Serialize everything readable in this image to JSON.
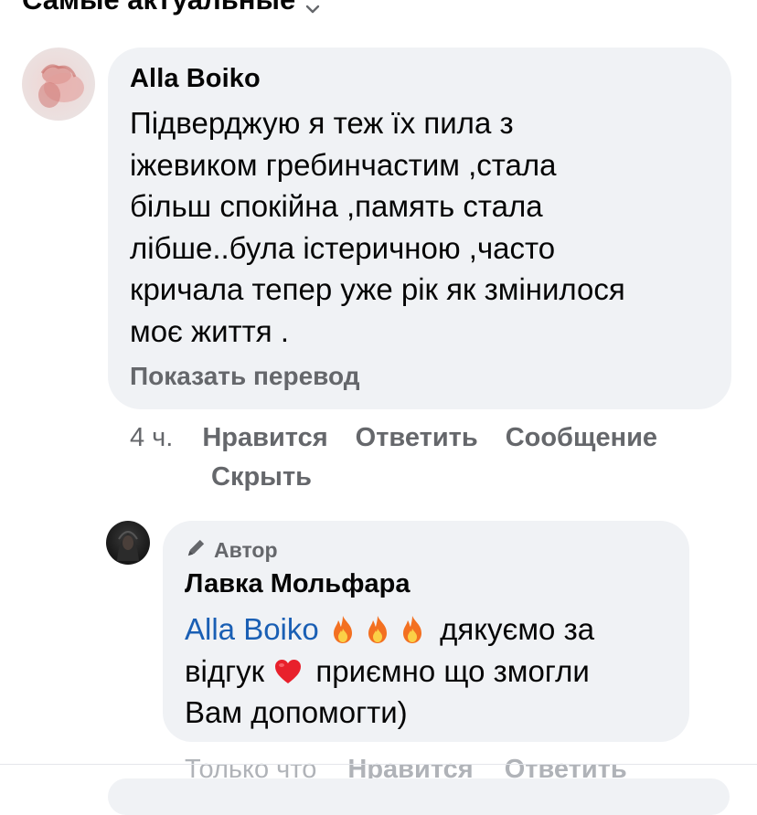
{
  "sort": {
    "label": "Самые актуальные"
  },
  "comment": {
    "author": "Alla Boiko",
    "lines": [
      "Підверджую я теж їх пила з",
      "іжевиком гребинчастим ,стала",
      "більш спокійна ,память стала",
      "лібше..була істеричною ,часто",
      "кричала тепер уже рік як змінилося",
      "моє життя ."
    ],
    "translate": "Показать перевод",
    "time": "4 ч.",
    "like": "Нравится",
    "reply": "Ответить",
    "message": "Сообщение",
    "hide": "Скрыть"
  },
  "reply": {
    "badge": "Автор",
    "author": "Лавка Мольфара",
    "mention": "Alla Boiko",
    "text_after_fire": " дякуємо за",
    "line2_before_heart": "відгук ",
    "line2_after_heart": " приємно що змогли",
    "line3": "Вам допомогти)",
    "time": "Только что",
    "like": "Нравится",
    "reply": "Ответить"
  },
  "icons": {
    "sort_chevron": "chevron-down-icon",
    "author_badge": "pencil-icon",
    "emoji_fire": "fire-icon",
    "emoji_heart": "heart-icon"
  }
}
